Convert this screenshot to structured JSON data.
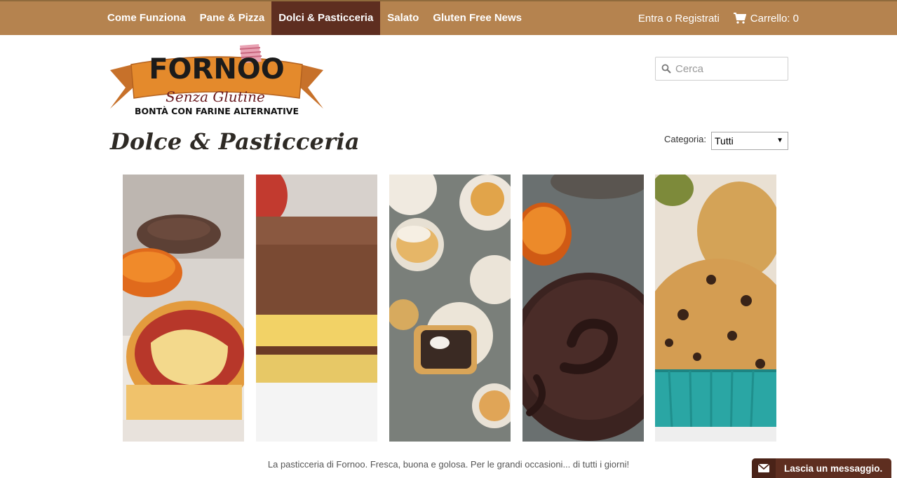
{
  "nav": {
    "items": [
      {
        "label": "Come Funziona",
        "active": false
      },
      {
        "label": "Pane & Pizza",
        "active": false
      },
      {
        "label": "Dolci & Pasticceria",
        "active": true
      },
      {
        "label": "Salato",
        "active": false
      },
      {
        "label": "Gluten Free News",
        "active": false
      }
    ],
    "login_label": "Entra o Registrati",
    "cart_label": "Carrello: 0"
  },
  "logo": {
    "name": "FORNOO",
    "subtitle": "Senza Glutine",
    "tagline": "BONTÀ CON FARINE ALTERNATIVE"
  },
  "search": {
    "placeholder": "Cerca"
  },
  "page": {
    "title": "Dolce & Pasticceria",
    "category_label": "Categoria:",
    "category_selected": "Tutti"
  },
  "products": [
    {
      "name": "crostatina-image"
    },
    {
      "name": "tiramisu-image"
    },
    {
      "name": "bigne-image"
    },
    {
      "name": "chocolate-tart-image"
    },
    {
      "name": "muffin-image"
    }
  ],
  "footer": {
    "tagline": "La pasticceria di Fornoo. Fresca, buona e golosa. Per le grandi occasioni... di tutti i giorni!"
  },
  "message_widget": {
    "label": "Lascia un messaggio."
  },
  "colors": {
    "nav_bg": "#b5834f",
    "nav_active": "#5e2e20",
    "widget_bg": "#5e2e20",
    "logo_orange": "#e48a2c",
    "logo_pink": "#e9a3b4"
  }
}
